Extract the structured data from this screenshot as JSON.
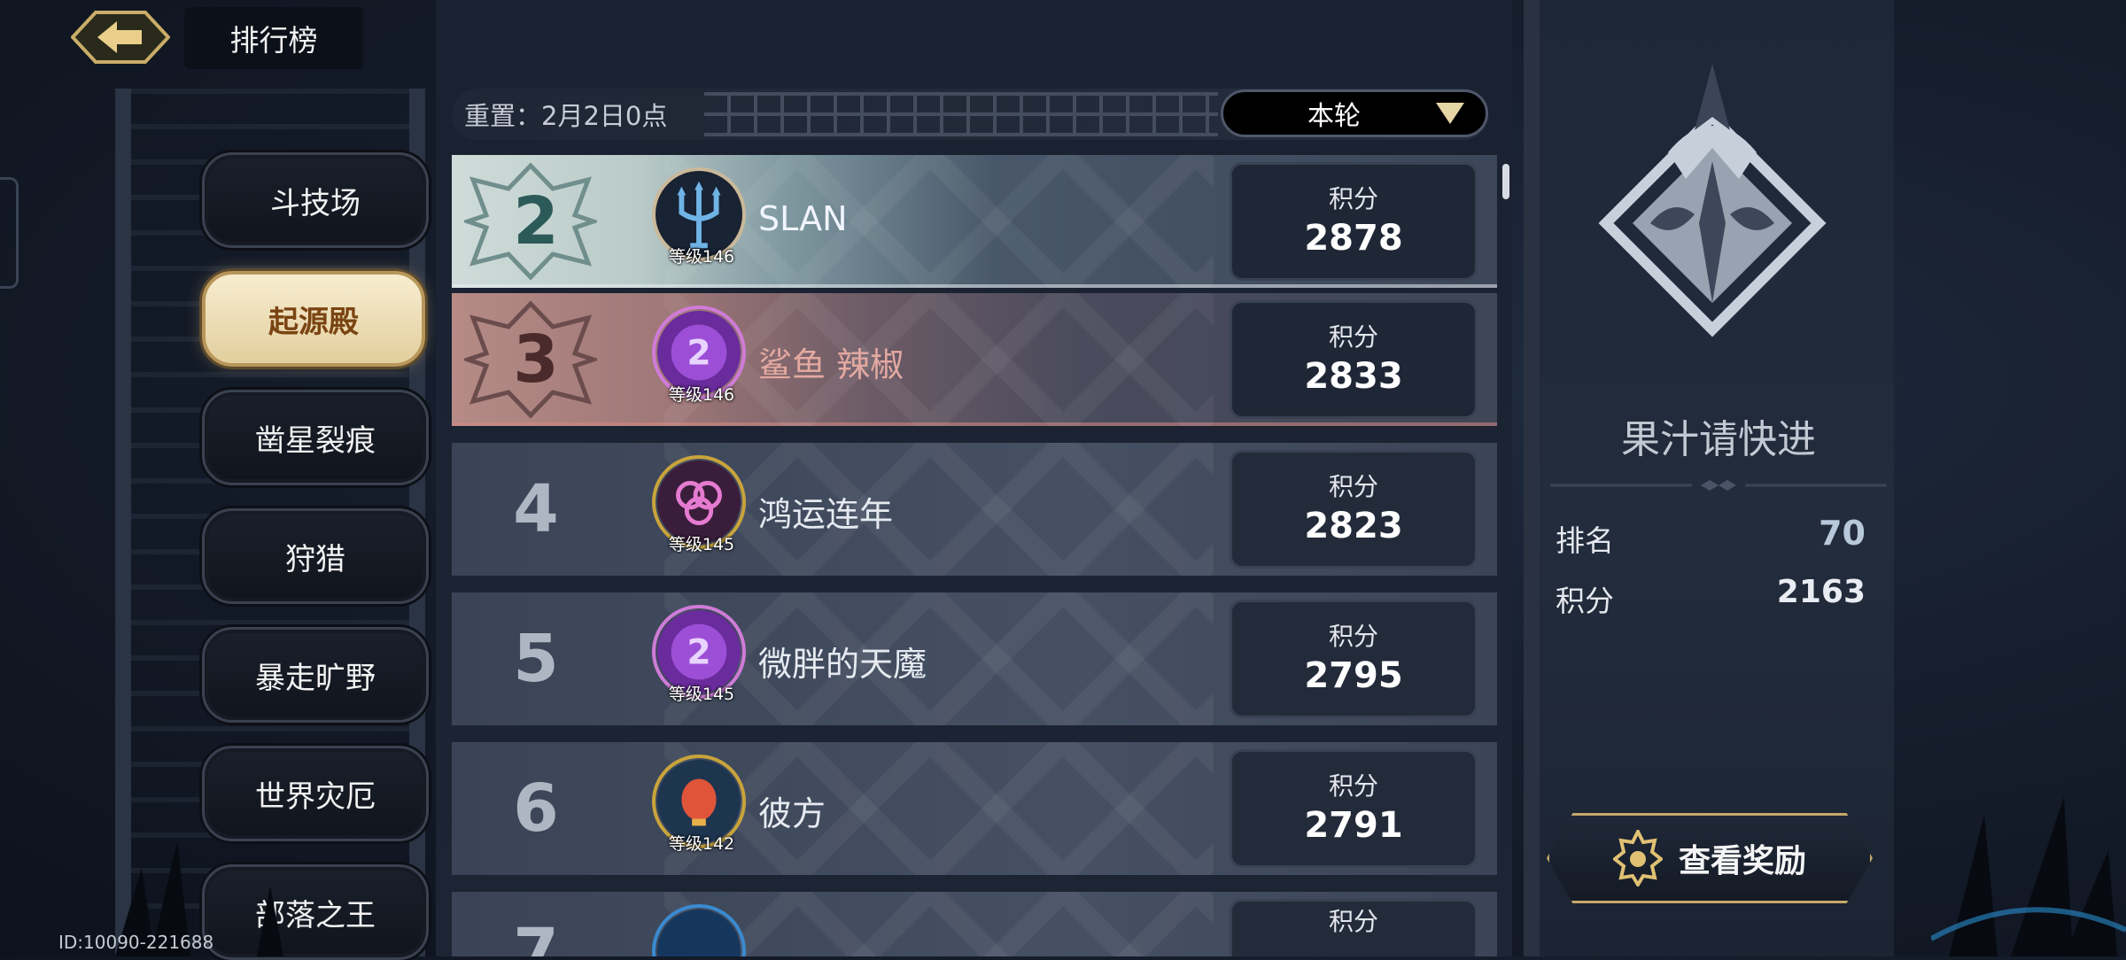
{
  "header": {
    "back_icon": "back-arrow-icon",
    "title": "排行榜"
  },
  "nav": {
    "items": [
      {
        "label": "斗技场",
        "active": false
      },
      {
        "label": "起源殿",
        "active": true
      },
      {
        "label": "凿星裂痕",
        "active": false
      },
      {
        "label": "狩猎",
        "active": false
      },
      {
        "label": "暴走旷野",
        "active": false
      },
      {
        "label": "世界灾厄",
        "active": false
      },
      {
        "label": "部落之王",
        "active": false
      }
    ]
  },
  "list": {
    "reset_text": "重置：2月2日0点",
    "dropdown_selected": "本轮",
    "score_label": "积分",
    "rows": [
      {
        "rank": "2",
        "name": "SLAN",
        "level": "等级146",
        "score": "2878",
        "avatar": "trident-avatar"
      },
      {
        "rank": "3",
        "name": "鲨鱼 辣椒",
        "level": "等级146",
        "score": "2833",
        "avatar": "purple-2nd-avatar"
      },
      {
        "rank": "4",
        "name": "鸿运连年",
        "level": "等级145",
        "score": "2823",
        "avatar": "pink-flower-avatar"
      },
      {
        "rank": "5",
        "name": "微胖的天魔",
        "level": "等级145",
        "score": "2795",
        "avatar": "purple-2nd-avatar"
      },
      {
        "rank": "6",
        "name": "彼方",
        "level": "等级142",
        "score": "2791",
        "avatar": "lantern-avatar"
      },
      {
        "rank": "7",
        "name": "",
        "level": "",
        "score": "",
        "avatar": "blue-avatar"
      }
    ]
  },
  "guild": {
    "name": "果汁请快进",
    "rank_label": "排名",
    "rank_value": "70",
    "score_label": "积分",
    "score_value": "2163",
    "reward_button": "查看奖励",
    "reward_icon": "medal-icon"
  },
  "footer": {
    "id_text": "ID:10090-221688"
  },
  "colors": {
    "accent_gold": "#c7a86a",
    "active_nav_bg": "#f1e4bf",
    "active_nav_text": "#7a4412"
  }
}
